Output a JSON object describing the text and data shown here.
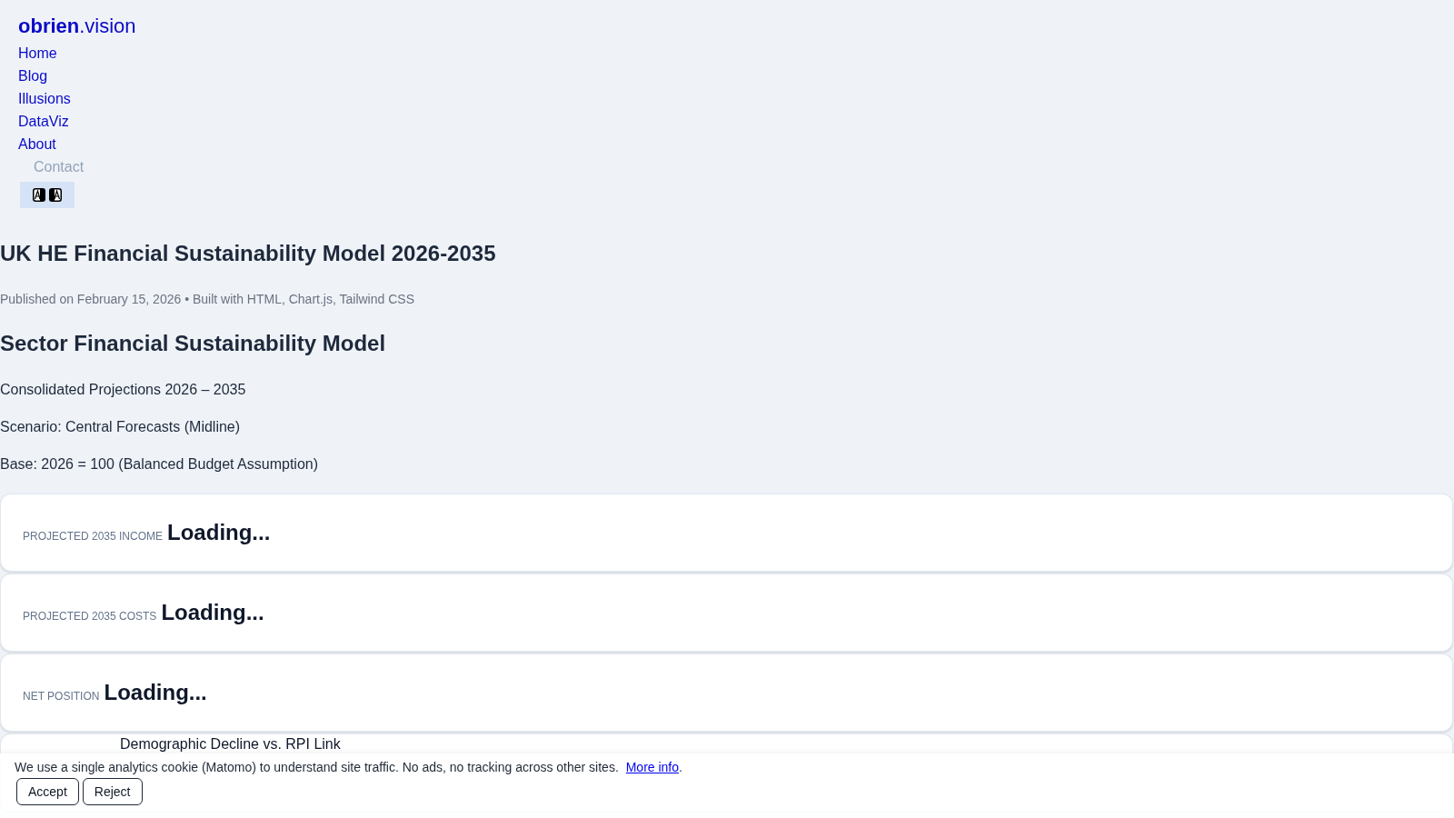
{
  "site": {
    "logo": "**obrien**.vision"
  },
  "nav": [
    {
      "label": "Home",
      "kind": "link"
    },
    {
      "label": "Blog",
      "kind": "link"
    },
    {
      "label": "Illusions",
      "kind": "link"
    },
    {
      "label": "DataViz",
      "kind": "link"
    },
    {
      "label": "About",
      "kind": "link"
    },
    {
      "label": "Contact",
      "kind": "button"
    }
  ],
  "article": {
    "title": "UK HE Financial Sustainability Model 2026-2035",
    "meta": "Published on February 15, 2026 • Built with HTML, Chart.js, Tailwind CSS",
    "section_title": "Sector Financial Sustainability Model",
    "paragraphs": [
      "Consolidated Projections 2026 – 2035",
      "Scenario: Central Forecasts (Midline)",
      "Base: 2026 = 100 (Balanced Budget Assumption)"
    ]
  },
  "stat_cards": [
    {
      "kind": "metric",
      "label": "PROJECTED 2035 INCOME",
      "value": "Loading..."
    },
    {
      "kind": "metric",
      "label": "PROJECTED 2035 COSTS",
      "value": "Loading..."
    },
    {
      "kind": "metric",
      "label": "NET POSITION",
      "value": "Loading..."
    },
    {
      "kind": "text",
      "value": "Demographic Decline vs. RPI Link"
    }
  ],
  "cookie_banner": {
    "text": "We use a single analytics cookie (Matomo) to understand site traffic. No ads, no tracking across other sites.",
    "link": "More info",
    "after_link": ".",
    "buttons": [
      "Accept",
      "Reject"
    ]
  }
}
